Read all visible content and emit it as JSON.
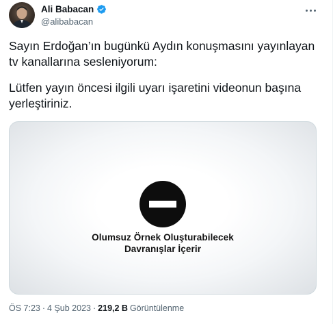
{
  "author": {
    "display_name": "Ali Babacan",
    "handle": "@alibabacan",
    "verified": true,
    "verified_color": "#1d9bf0"
  },
  "tweet": {
    "paragraphs": [
      "Sayın Erdoğan’ın bugünkü Aydın konuşmasını yayınlayan tv kanallarına sesleniyorum:",
      "Lütfen yayın öncesi ilgili uyarı işaretini videonun başına yerleştiriniz."
    ]
  },
  "media": {
    "icon": "no-entry-icon",
    "warning_line1": "Olumsuz Örnek Oluşturabilecek",
    "warning_line2": "Davranışlar İçerir"
  },
  "meta": {
    "time": "ÖS 7:23",
    "separator": "·",
    "date": "4 Şub 2023",
    "views_count": "219,2 B",
    "views_label": "Görüntülenme"
  },
  "colors": {
    "text_primary": "#0f1419",
    "text_secondary": "#536471",
    "accent": "#1d9bf0"
  }
}
